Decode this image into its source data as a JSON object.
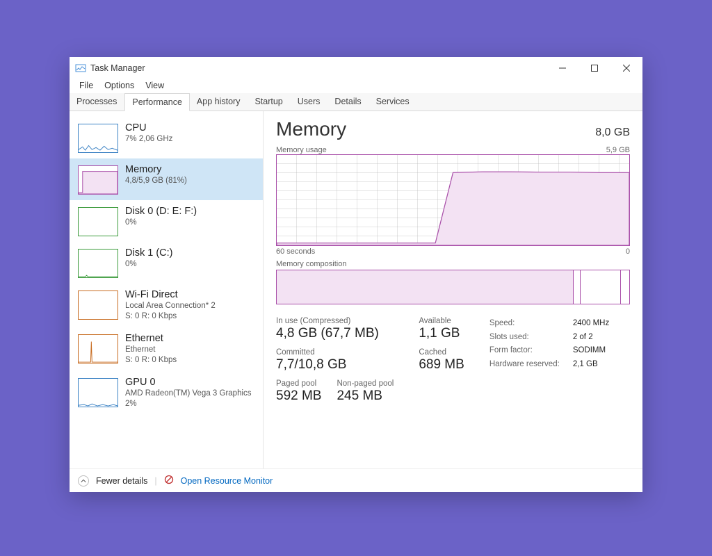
{
  "window": {
    "title": "Task Manager"
  },
  "menus": [
    "File",
    "Options",
    "View"
  ],
  "tabs": [
    "Processes",
    "Performance",
    "App history",
    "Startup",
    "Users",
    "Details",
    "Services"
  ],
  "active_tab": "Performance",
  "sidebar": [
    {
      "title": "CPU",
      "sub": "7%  2,06 GHz",
      "color": "#3b82c4"
    },
    {
      "title": "Memory",
      "sub": "4,8/5,9 GB (81%)",
      "color": "#a94fa9",
      "selected": true
    },
    {
      "title": "Disk 0 (D: E: F:)",
      "sub": "0%",
      "color": "#3a9a3a"
    },
    {
      "title": "Disk 1 (C:)",
      "sub": "0%",
      "color": "#3a9a3a"
    },
    {
      "title": "Wi-Fi Direct",
      "sub": "Local Area Connection* 2",
      "sub2": "S: 0  R: 0 Kbps",
      "color": "#c76a1e"
    },
    {
      "title": "Ethernet",
      "sub": "Ethernet",
      "sub2": "S: 0  R: 0 Kbps",
      "color": "#c76a1e"
    },
    {
      "title": "GPU 0",
      "sub": "AMD Radeon(TM) Vega 3 Graphics",
      "sub2": "2%",
      "color": "#3b82c4"
    }
  ],
  "detail": {
    "heading": "Memory",
    "capacity": "8,0 GB",
    "chart_title": "Memory usage",
    "chart_max": "5,9 GB",
    "x_left": "60 seconds",
    "x_right": "0",
    "comp_title": "Memory composition",
    "stats": {
      "in_use_label": "In use (Compressed)",
      "in_use": "4,8 GB (67,7 MB)",
      "available_label": "Available",
      "available": "1,1 GB",
      "committed_label": "Committed",
      "committed": "7,7/10,8 GB",
      "cached_label": "Cached",
      "cached": "689 MB",
      "paged_label": "Paged pool",
      "paged": "592 MB",
      "nonpaged_label": "Non-paged pool",
      "nonpaged": "245 MB"
    },
    "specs": {
      "speed_k": "Speed:",
      "speed_v": "2400 MHz",
      "slots_k": "Slots used:",
      "slots_v": "2 of 2",
      "form_k": "Form factor:",
      "form_v": "SODIMM",
      "hw_k": "Hardware reserved:",
      "hw_v": "2,1 GB"
    }
  },
  "footer": {
    "fewer": "Fewer details",
    "orm": "Open Resource Monitor"
  },
  "chart_data": {
    "type": "area",
    "title": "Memory usage",
    "xlabel": "seconds ago",
    "ylabel": "GB",
    "xlim": [
      60,
      0
    ],
    "ylim": [
      0,
      5.9
    ],
    "x": [
      60,
      55,
      50,
      45,
      40,
      35,
      33,
      30,
      25,
      20,
      15,
      10,
      5,
      0
    ],
    "values": [
      0.15,
      0.15,
      0.15,
      0.15,
      0.15,
      0.15,
      0.15,
      4.75,
      4.8,
      4.8,
      4.78,
      4.78,
      4.75,
      4.75
    ]
  },
  "composition": [
    {
      "name": "in-use",
      "fraction": 0.84,
      "fill": "#f3e2f3"
    },
    {
      "name": "modified",
      "fraction": 0.02,
      "fill": "#ffffff"
    },
    {
      "name": "standby",
      "fraction": 0.115,
      "fill": "#ffffff"
    },
    {
      "name": "free",
      "fraction": 0.025,
      "fill": "#ffffff"
    }
  ]
}
